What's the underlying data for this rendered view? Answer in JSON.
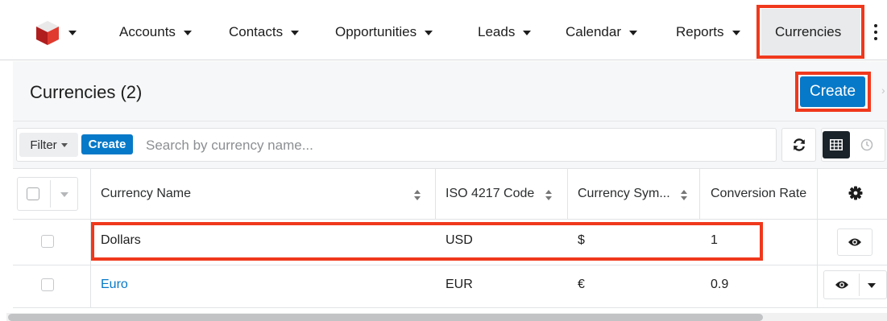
{
  "nav": {
    "items": [
      {
        "label": "Accounts"
      },
      {
        "label": "Contacts"
      },
      {
        "label": "Opportunities"
      },
      {
        "label": "Leads"
      },
      {
        "label": "Calendar"
      },
      {
        "label": "Reports"
      }
    ],
    "active": "Currencies"
  },
  "header": {
    "title": "Currencies (2)",
    "create_label": "Create"
  },
  "filter": {
    "label": "Filter",
    "create_label": "Create",
    "search_placeholder": "Search by currency name..."
  },
  "table": {
    "columns": [
      "Currency Name",
      "ISO 4217 Code",
      "Currency Sym...",
      "Conversion Rate"
    ],
    "rows": [
      {
        "name": "Dollars",
        "code": "USD",
        "symbol": "$",
        "rate": "1"
      },
      {
        "name": "Euro",
        "code": "EUR",
        "symbol": "€",
        "rate": "0.9"
      }
    ]
  },
  "colors": {
    "accent": "#0679c8",
    "annotation": "#f0381c"
  }
}
